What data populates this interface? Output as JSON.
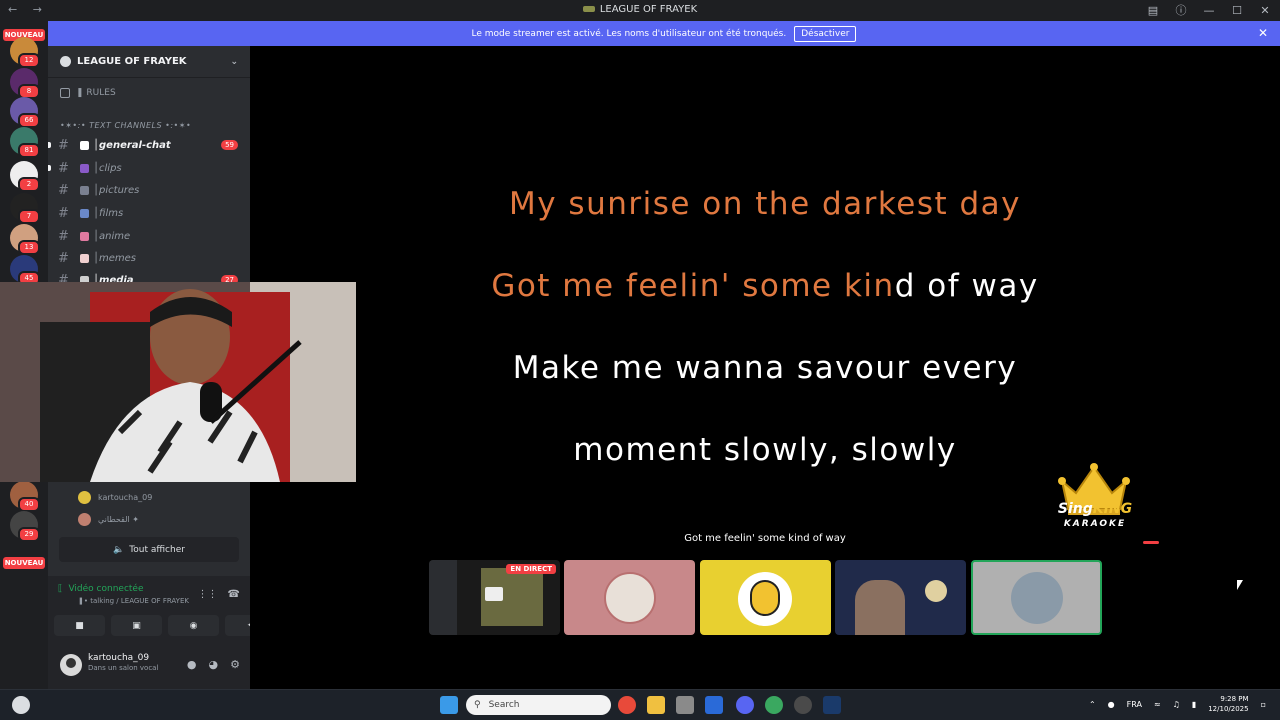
{
  "titlebar": {
    "title": "LEAGUE OF FRAYEK",
    "nav": "← →",
    "icons": [
      "monitor-icon",
      "help-icon",
      "minimize-icon",
      "maximize-icon",
      "close-icon"
    ]
  },
  "banner": {
    "text": "Le mode streamer est activé. Les noms d'utilisateur ont été tronqués.",
    "button": "Désactiver",
    "close": "✕"
  },
  "servers": {
    "nouveau_label": "NOUVEAU",
    "badges": [
      "12",
      "8",
      "66",
      "81",
      "2",
      "7",
      "13",
      "45",
      "40",
      "29"
    ]
  },
  "guild": {
    "name": "LEAGUE OF FRAYEK",
    "rules_label": "❚ RULES",
    "category": "•✶•:• TEXT CHANNELS •:•✶•",
    "channels": [
      {
        "label": "│general-chat",
        "count": "59"
      },
      {
        "label": "│clips"
      },
      {
        "label": "│pictures"
      },
      {
        "label": "│films"
      },
      {
        "label": "│anime"
      },
      {
        "label": "│memes"
      },
      {
        "label": "│media",
        "count": "27"
      }
    ],
    "voice_users": [
      "kartoucha_09",
      "القحطاني ✦"
    ],
    "show_all": "Tout afficher"
  },
  "voice_panel": {
    "status": "Vidéo connectée",
    "sub": "❚• talking / LEAGUE OF FRAYEK"
  },
  "user": {
    "name": "kartoucha_09",
    "status": "Dans un salon vocal"
  },
  "stage": {
    "lyric1": "My sunrise on the darkest day",
    "lyric2_sung": "Got me feelin' some kin",
    "lyric2_rest": "d of way",
    "lyric3": "Make me wanna savour every",
    "lyric4": "moment slowly, slowly",
    "brand_sing": "Sing",
    "brand_king": "KING",
    "brand_karaoke": "KARAOKE",
    "caption": "Got me feelin' some kind of way",
    "live_label": "EN DIRECT"
  },
  "taskbar": {
    "search_placeholder": "Search",
    "lang": "FRA",
    "time": "9:28 PM",
    "date": "12/10/2025"
  },
  "colors": {
    "sung": "#e07840",
    "banner": "#5865f2",
    "badge": "#f23f43"
  }
}
